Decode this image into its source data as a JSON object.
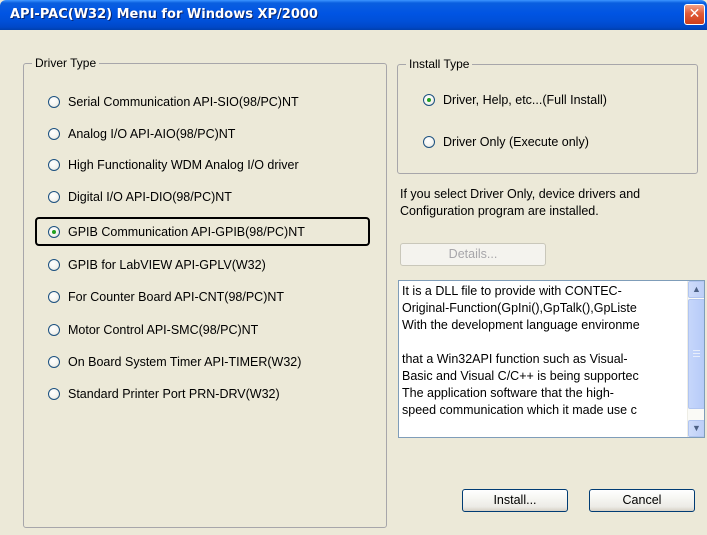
{
  "window": {
    "title": "API-PAC(W32) Menu for Windows XP/2000",
    "close_glyph": "✕"
  },
  "driver_type": {
    "legend": "Driver Type",
    "options": [
      {
        "label": "Serial Communication API-SIO(98/PC)NT",
        "checked": false
      },
      {
        "label": "Analog I/O API-AIO(98/PC)NT",
        "checked": false
      },
      {
        "label": "High Functionality WDM Analog I/O driver",
        "checked": false
      },
      {
        "label": "Digital I/O API-DIO(98/PC)NT",
        "checked": false
      },
      {
        "label": "GPIB Communication API-GPIB(98/PC)NT",
        "checked": true
      },
      {
        "label": "GPIB for LabVIEW API-GPLV(W32)",
        "checked": false
      },
      {
        "label": "For Counter Board API-CNT(98/PC)NT",
        "checked": false
      },
      {
        "label": "Motor Control API-SMC(98/PC)NT",
        "checked": false
      },
      {
        "label": "On Board System Timer API-TIMER(W32)",
        "checked": false
      },
      {
        "label": "Standard Printer Port PRN-DRV(W32)",
        "checked": false
      }
    ]
  },
  "install_type": {
    "legend": "Install Type",
    "options": [
      {
        "label": "Driver, Help, etc...(Full Install)",
        "checked": true
      },
      {
        "label": "Driver Only (Execute only)",
        "checked": false
      }
    ]
  },
  "info": {
    "line1": "If you select Driver Only, device drivers and",
    "line2": "Configuration program are installed."
  },
  "details_button": "Details...",
  "description": {
    "lines": [
      "It is a DLL file to provide with CONTEC-",
      "Original-Function(GpIni(),GpTalk(),GpListe",
      "With the development language environme",
      "",
      "that a Win32API function such as Visual-",
      "Basic and Visual C/C++ is being supportec",
      "The application software that the high-",
      "speed communication which it made use c"
    ]
  },
  "buttons": {
    "install": "Install...",
    "cancel": "Cancel"
  },
  "colors": {
    "title_bar": "#0054e3",
    "dialog_bg": "#ece9d8",
    "radio_dot": "#21a121",
    "close_button": "#cf3e1b"
  }
}
